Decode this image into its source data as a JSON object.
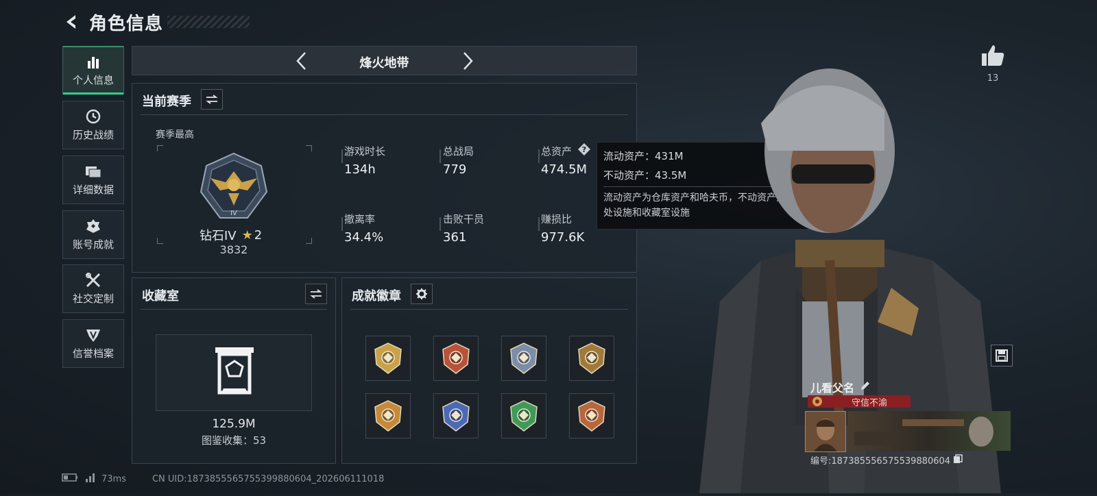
{
  "header": {
    "title": "角色信息"
  },
  "sidebar": {
    "items": [
      {
        "label": "个人信息",
        "icon": "bar-chart-icon",
        "active": true
      },
      {
        "label": "历史战绩",
        "icon": "clock-icon"
      },
      {
        "label": "详细数据",
        "icon": "folder-icon"
      },
      {
        "label": "账号成就",
        "icon": "achievement-icon"
      },
      {
        "label": "社交定制",
        "icon": "tools-icon"
      },
      {
        "label": "信誉档案",
        "icon": "shield-icon"
      }
    ]
  },
  "mode": {
    "title": "烽火地带"
  },
  "season": {
    "title": "当前赛季",
    "highest_label": "赛季最高",
    "rank_name": "钻石IV",
    "rank_stars": "2",
    "rank_points": "3832",
    "stats": [
      {
        "label": "游戏时长",
        "value": "134h"
      },
      {
        "label": "总战局",
        "value": "779"
      },
      {
        "label": "总资产",
        "value": "474.5M"
      },
      {
        "label": "撤离率",
        "value": "34.4%"
      },
      {
        "label": "击败干员",
        "value": "361"
      },
      {
        "label": "赚损比",
        "value": "977.6K"
      }
    ]
  },
  "tooltip": {
    "liquid": "流动资产：431M",
    "fixed": "不动资产：43.5M",
    "desc": "流动资产为仓库资产和哈夫币，不动资产为特勤处设施和收藏室设施"
  },
  "collection": {
    "title": "收藏室",
    "value": "125.9M",
    "collected": "图鉴收集：53"
  },
  "badges": {
    "title": "成就徽章",
    "items": [
      {
        "name": "badge-1",
        "color": "#c9a14a"
      },
      {
        "name": "badge-2",
        "color": "#b8523a"
      },
      {
        "name": "badge-3",
        "color": "#7c8da8"
      },
      {
        "name": "badge-4",
        "color": "#a07a3c"
      },
      {
        "name": "badge-5",
        "color": "#c48a3a"
      },
      {
        "name": "badge-6",
        "color": "#4a6ab8"
      },
      {
        "name": "badge-7",
        "color": "#3f9a5a"
      },
      {
        "name": "badge-8",
        "color": "#b8663e"
      }
    ]
  },
  "likes": {
    "count": "13"
  },
  "player": {
    "name": "儿看父名",
    "title_badge": "守信不渝",
    "id": "编号:1873855565755398806​04"
  },
  "footer": {
    "ping": "73ms",
    "uid": "CN UID:18738555657553998806​04_202606111018"
  },
  "colors": {
    "accent": "#2fd18a",
    "title_badge_bg": "#8a1f22"
  }
}
